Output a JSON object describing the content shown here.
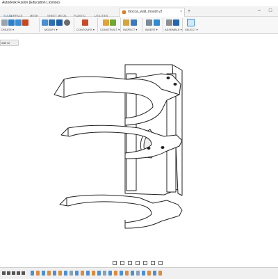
{
  "window": {
    "app_title": "Autodesk Fusion (Education License)",
    "minimize_glyph": "–",
    "maximize_glyph": "□"
  },
  "document_tab": {
    "label": "mocca_wall_mount v2",
    "close_glyph": "×"
  },
  "add_tab_glyph": "+",
  "ribbon": {
    "tabs": [
      "SOLID",
      "SURFACE",
      "MESH",
      "SHEET METAL",
      "PLASTIC",
      "UTILITIES"
    ],
    "groups": [
      "CREATE ▾",
      "MODIFY ▾",
      "CONTOURS ▾",
      "CONSTRUCT ▾",
      "INSPECT ▾",
      "INSERT ▾",
      "ASSEMBLE ▾",
      "SELECT ▾"
    ]
  },
  "browser": {
    "label": "wall v2"
  },
  "colors": {
    "accent": "#0a6fc2",
    "tab_icon": "#e07c1d",
    "model_line": "#222222",
    "model_fill": "#ffffff"
  }
}
